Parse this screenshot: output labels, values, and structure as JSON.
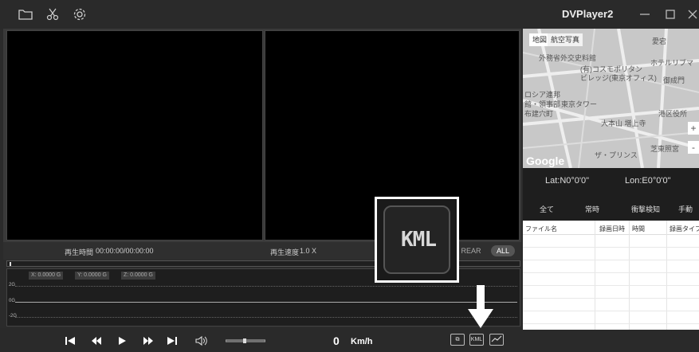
{
  "app": {
    "title": "DVPlayer2"
  },
  "toolbar": {
    "icons": [
      "folder-icon",
      "scissors-icon",
      "gear-icon"
    ]
  },
  "window_controls": {
    "icons": [
      "minimize-icon",
      "maximize-icon",
      "close-icon"
    ]
  },
  "status": {
    "time_label": "再生時間",
    "time_value": "00:00:00/00:00:00",
    "speed_label": "再生速度",
    "speed_value": "1.0 X",
    "rear_label": "REAR",
    "all_label": "ALL"
  },
  "gsensor": {
    "x_label": "X: 0.0000 G",
    "y_label": "Y: 0.0000 G",
    "z_label": "Z: 0.0000 G",
    "scale": [
      "2G",
      "0G",
      "-2G"
    ]
  },
  "controls": {
    "speed": "0",
    "speed_unit": "Km/h",
    "kml_label": "KML"
  },
  "map": {
    "tab_map": "地図",
    "tab_satellite": "航空写真",
    "labels": [
      "外務省外交史料館",
      "(有)コスモポリタン",
      "ビレッジ(東京オフィス)",
      "ロシア連邦",
      "館・領事部",
      "東京タワー",
      "布建穴町",
      "大本山 増上寺",
      "港区役所",
      "芝東照宮",
      "ザ・プリンス",
      "ホテルリブマ",
      "御成門",
      "愛宕"
    ],
    "logo": "Google",
    "zoom_in": "+",
    "zoom_out": "-"
  },
  "gps": {
    "lat": "Lat:N0°0'0\"",
    "lon": "Lon:E0°0'0\""
  },
  "filters": [
    "全て",
    "常時",
    "衝撃検知",
    "手動"
  ],
  "file_table": {
    "columns": [
      "ファイル名",
      "録画日時",
      "時間",
      "録画タイプ"
    ]
  },
  "callout": {
    "text": "KML"
  },
  "colors": {
    "accent": "#ffffff",
    "background": "#2b2b2b",
    "video": "#000000"
  }
}
